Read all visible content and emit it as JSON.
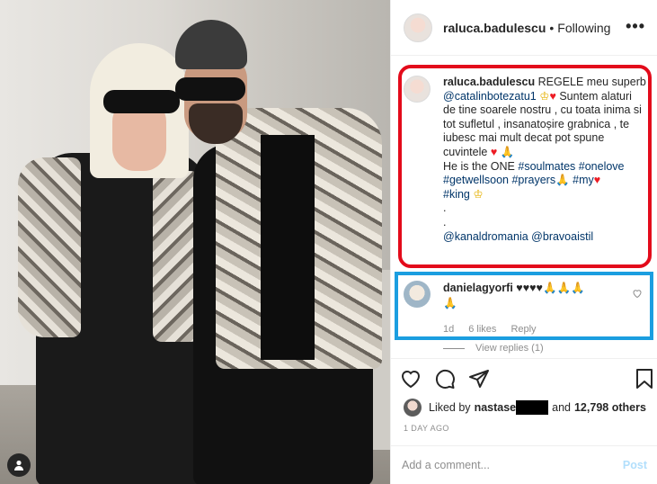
{
  "post": {
    "username": "raluca.badulescu",
    "separator": "•",
    "follow_status": "Following",
    "more_label": "•••"
  },
  "caption": {
    "username": "raluca.badulescu",
    "line1": "REGELE meu superb",
    "mention1": "@catalinbotezatu1",
    "line2": " Suntem alaturi de tine soarele nostru , cu toata inima si tot sufletul , insanatoșire grabnica , te iubesc mai mult decat pot spune cuvintele",
    "line3": "He is the ONE",
    "tags1": "#soulmates #onelove #getwellsoon #prayers",
    "tag_my": "#my",
    "tag_king": "#king",
    "dots": ".",
    "mention2": "@kanaldromania",
    "mention3": "@bravoaistil",
    "heart": "♥",
    "crown": "♔",
    "hands": "🙏"
  },
  "comment": {
    "username": "danielagyorfi",
    "text": "♥♥♥♥",
    "hands": "🙏🙏🙏",
    "hands2": "🙏",
    "age": "1d",
    "likes": "6 likes",
    "reply": "Reply",
    "view_replies": "View replies (1)"
  },
  "likes": {
    "prefix": "Liked by",
    "user": "nastase",
    "suffix": "and",
    "count": "12,798 others"
  },
  "timestamp": "1 DAY AGO",
  "add_comment": {
    "placeholder": "Add a comment...",
    "post": "Post"
  },
  "icons": {
    "heart": "heart-outline-icon",
    "comment": "speech-bubble-icon",
    "share": "paper-plane-icon",
    "bookmark": "bookmark-icon",
    "accounts": "person-tag-icon"
  },
  "colors": {
    "annotation_red": "#e30b1b",
    "annotation_blue": "#1b9ee0",
    "link": "#003569",
    "post_disabled": "#b2dffc"
  }
}
